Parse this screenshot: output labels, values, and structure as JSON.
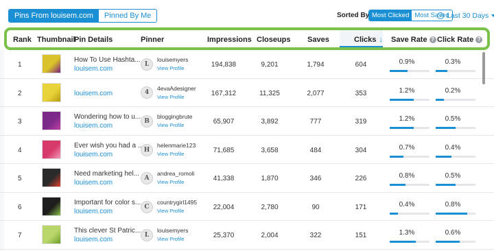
{
  "toolbar": {
    "tabs": [
      {
        "label": "Pins From louisem.com",
        "active": true
      },
      {
        "label": "Pinned By Me",
        "active": false
      }
    ],
    "sorted_by_label": "Sorted By",
    "sort_options": [
      {
        "label": "Most Clicked",
        "active": true
      },
      {
        "label": "Most Saved",
        "active": false
      }
    ],
    "date_range": "Last 30 Days",
    "accent_color": "#1a8fd3",
    "highlight_color": "#7ac24a"
  },
  "columns": {
    "rank": "Rank",
    "thumbnail": "Thumbnail",
    "pin_details": "Pin Details",
    "pinner": "Pinner",
    "impressions": "Impressions",
    "closeups": "Closeups",
    "saves": "Saves",
    "clicks": "Clicks",
    "clicks_sort_icon": "↓",
    "save_rate": "Save Rate",
    "click_rate": "Click Rate",
    "help_glyph": "?"
  },
  "rows": [
    {
      "rank": "1",
      "title": "How To Use Hashta...",
      "link": "louisem.com",
      "avatar": "L",
      "pinner": "louisemyers",
      "view_profile": "View Profile",
      "impressions": "194,838",
      "closeups": "9,201",
      "saves": "1,794",
      "clicks": "604",
      "save_rate": "0.9%",
      "save_rate_value": 0.9,
      "click_rate": "0.3%",
      "click_rate_value": 0.3,
      "thumb_color": "#d9c22b",
      "thumb_accent": "#7a1f7a"
    },
    {
      "rank": "2",
      "title": "",
      "link": "louisem.com",
      "avatar": "4",
      "pinner": "4evaAdesigner",
      "view_profile": "View Profile",
      "impressions": "167,312",
      "closeups": "11,325",
      "saves": "2,077",
      "clicks": "353",
      "save_rate": "1.2%",
      "save_rate_value": 1.2,
      "click_rate": "0.2%",
      "click_rate_value": 0.2,
      "thumb_color": "#e8d43a",
      "thumb_accent": "#b89a10"
    },
    {
      "rank": "3",
      "title": "Wondering how to u...",
      "link": "louisem.com",
      "avatar": "B",
      "pinner": "bloggingbrute",
      "view_profile": "View Profile",
      "impressions": "65,907",
      "closeups": "3,892",
      "saves": "777",
      "clicks": "319",
      "save_rate": "1.2%",
      "save_rate_value": 1.2,
      "click_rate": "0.5%",
      "click_rate_value": 0.5,
      "thumb_color": "#7b2a8a",
      "thumb_accent": "#c03da0"
    },
    {
      "rank": "4",
      "title": "Ever wish you had a ...",
      "link": "louisem.com",
      "avatar": "H",
      "pinner": "helenmarie123",
      "view_profile": "View Profile",
      "impressions": "71,685",
      "closeups": "3,658",
      "saves": "484",
      "clicks": "304",
      "save_rate": "0.7%",
      "save_rate_value": 0.7,
      "click_rate": "0.4%",
      "click_rate_value": 0.4,
      "thumb_color": "#d63a6a",
      "thumb_accent": "#f29ab8"
    },
    {
      "rank": "5",
      "title": "Need marketing hel...",
      "link": "louisem.com",
      "avatar": "A",
      "pinner": "andrea_romoli",
      "view_profile": "View Profile",
      "impressions": "41,338",
      "closeups": "1,870",
      "saves": "346",
      "clicks": "226",
      "save_rate": "0.8%",
      "save_rate_value": 0.8,
      "click_rate": "0.5%",
      "click_rate_value": 0.5,
      "thumb_color": "#2a2a2a",
      "thumb_accent": "#e0402f"
    },
    {
      "rank": "6",
      "title": "Important for color s...",
      "link": "louisem.com",
      "avatar": "C",
      "pinner": "countrygirl1495",
      "view_profile": "View Profile",
      "impressions": "22,004",
      "closeups": "2,780",
      "saves": "90",
      "clicks": "171",
      "save_rate": "0.4%",
      "save_rate_value": 0.4,
      "click_rate": "0.8%",
      "click_rate_value": 0.8,
      "thumb_color": "#1e1e1e",
      "thumb_accent": "#8bc34a"
    },
    {
      "rank": "7",
      "title": "This clever St Patric...",
      "link": "louisem.com",
      "avatar": "L",
      "pinner": "louisemyers",
      "view_profile": "View Profile",
      "impressions": "25,370",
      "closeups": "2,004",
      "saves": "322",
      "clicks": "151",
      "save_rate": "1.3%",
      "save_rate_value": 1.3,
      "click_rate": "0.6%",
      "click_rate_value": 0.6,
      "thumb_color": "#b9d66a",
      "thumb_accent": "#6f9e2a"
    }
  ]
}
